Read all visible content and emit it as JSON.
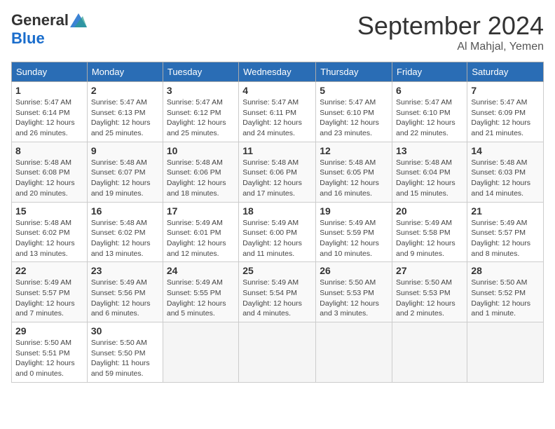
{
  "logo": {
    "general": "General",
    "blue": "Blue"
  },
  "title": "September 2024",
  "location": "Al Mahjal, Yemen",
  "days_of_week": [
    "Sunday",
    "Monday",
    "Tuesday",
    "Wednesday",
    "Thursday",
    "Friday",
    "Saturday"
  ],
  "weeks": [
    [
      {
        "day": "1",
        "sunrise": "Sunrise: 5:47 AM",
        "sunset": "Sunset: 6:14 PM",
        "daylight": "Daylight: 12 hours and 26 minutes."
      },
      {
        "day": "2",
        "sunrise": "Sunrise: 5:47 AM",
        "sunset": "Sunset: 6:13 PM",
        "daylight": "Daylight: 12 hours and 25 minutes."
      },
      {
        "day": "3",
        "sunrise": "Sunrise: 5:47 AM",
        "sunset": "Sunset: 6:12 PM",
        "daylight": "Daylight: 12 hours and 25 minutes."
      },
      {
        "day": "4",
        "sunrise": "Sunrise: 5:47 AM",
        "sunset": "Sunset: 6:11 PM",
        "daylight": "Daylight: 12 hours and 24 minutes."
      },
      {
        "day": "5",
        "sunrise": "Sunrise: 5:47 AM",
        "sunset": "Sunset: 6:10 PM",
        "daylight": "Daylight: 12 hours and 23 minutes."
      },
      {
        "day": "6",
        "sunrise": "Sunrise: 5:47 AM",
        "sunset": "Sunset: 6:10 PM",
        "daylight": "Daylight: 12 hours and 22 minutes."
      },
      {
        "day": "7",
        "sunrise": "Sunrise: 5:47 AM",
        "sunset": "Sunset: 6:09 PM",
        "daylight": "Daylight: 12 hours and 21 minutes."
      }
    ],
    [
      {
        "day": "8",
        "sunrise": "Sunrise: 5:48 AM",
        "sunset": "Sunset: 6:08 PM",
        "daylight": "Daylight: 12 hours and 20 minutes."
      },
      {
        "day": "9",
        "sunrise": "Sunrise: 5:48 AM",
        "sunset": "Sunset: 6:07 PM",
        "daylight": "Daylight: 12 hours and 19 minutes."
      },
      {
        "day": "10",
        "sunrise": "Sunrise: 5:48 AM",
        "sunset": "Sunset: 6:06 PM",
        "daylight": "Daylight: 12 hours and 18 minutes."
      },
      {
        "day": "11",
        "sunrise": "Sunrise: 5:48 AM",
        "sunset": "Sunset: 6:06 PM",
        "daylight": "Daylight: 12 hours and 17 minutes."
      },
      {
        "day": "12",
        "sunrise": "Sunrise: 5:48 AM",
        "sunset": "Sunset: 6:05 PM",
        "daylight": "Daylight: 12 hours and 16 minutes."
      },
      {
        "day": "13",
        "sunrise": "Sunrise: 5:48 AM",
        "sunset": "Sunset: 6:04 PM",
        "daylight": "Daylight: 12 hours and 15 minutes."
      },
      {
        "day": "14",
        "sunrise": "Sunrise: 5:48 AM",
        "sunset": "Sunset: 6:03 PM",
        "daylight": "Daylight: 12 hours and 14 minutes."
      }
    ],
    [
      {
        "day": "15",
        "sunrise": "Sunrise: 5:48 AM",
        "sunset": "Sunset: 6:02 PM",
        "daylight": "Daylight: 12 hours and 13 minutes."
      },
      {
        "day": "16",
        "sunrise": "Sunrise: 5:48 AM",
        "sunset": "Sunset: 6:02 PM",
        "daylight": "Daylight: 12 hours and 13 minutes."
      },
      {
        "day": "17",
        "sunrise": "Sunrise: 5:49 AM",
        "sunset": "Sunset: 6:01 PM",
        "daylight": "Daylight: 12 hours and 12 minutes."
      },
      {
        "day": "18",
        "sunrise": "Sunrise: 5:49 AM",
        "sunset": "Sunset: 6:00 PM",
        "daylight": "Daylight: 12 hours and 11 minutes."
      },
      {
        "day": "19",
        "sunrise": "Sunrise: 5:49 AM",
        "sunset": "Sunset: 5:59 PM",
        "daylight": "Daylight: 12 hours and 10 minutes."
      },
      {
        "day": "20",
        "sunrise": "Sunrise: 5:49 AM",
        "sunset": "Sunset: 5:58 PM",
        "daylight": "Daylight: 12 hours and 9 minutes."
      },
      {
        "day": "21",
        "sunrise": "Sunrise: 5:49 AM",
        "sunset": "Sunset: 5:57 PM",
        "daylight": "Daylight: 12 hours and 8 minutes."
      }
    ],
    [
      {
        "day": "22",
        "sunrise": "Sunrise: 5:49 AM",
        "sunset": "Sunset: 5:57 PM",
        "daylight": "Daylight: 12 hours and 7 minutes."
      },
      {
        "day": "23",
        "sunrise": "Sunrise: 5:49 AM",
        "sunset": "Sunset: 5:56 PM",
        "daylight": "Daylight: 12 hours and 6 minutes."
      },
      {
        "day": "24",
        "sunrise": "Sunrise: 5:49 AM",
        "sunset": "Sunset: 5:55 PM",
        "daylight": "Daylight: 12 hours and 5 minutes."
      },
      {
        "day": "25",
        "sunrise": "Sunrise: 5:49 AM",
        "sunset": "Sunset: 5:54 PM",
        "daylight": "Daylight: 12 hours and 4 minutes."
      },
      {
        "day": "26",
        "sunrise": "Sunrise: 5:50 AM",
        "sunset": "Sunset: 5:53 PM",
        "daylight": "Daylight: 12 hours and 3 minutes."
      },
      {
        "day": "27",
        "sunrise": "Sunrise: 5:50 AM",
        "sunset": "Sunset: 5:53 PM",
        "daylight": "Daylight: 12 hours and 2 minutes."
      },
      {
        "day": "28",
        "sunrise": "Sunrise: 5:50 AM",
        "sunset": "Sunset: 5:52 PM",
        "daylight": "Daylight: 12 hours and 1 minute."
      }
    ],
    [
      {
        "day": "29",
        "sunrise": "Sunrise: 5:50 AM",
        "sunset": "Sunset: 5:51 PM",
        "daylight": "Daylight: 12 hours and 0 minutes."
      },
      {
        "day": "30",
        "sunrise": "Sunrise: 5:50 AM",
        "sunset": "Sunset: 5:50 PM",
        "daylight": "Daylight: 11 hours and 59 minutes."
      },
      null,
      null,
      null,
      null,
      null
    ]
  ]
}
